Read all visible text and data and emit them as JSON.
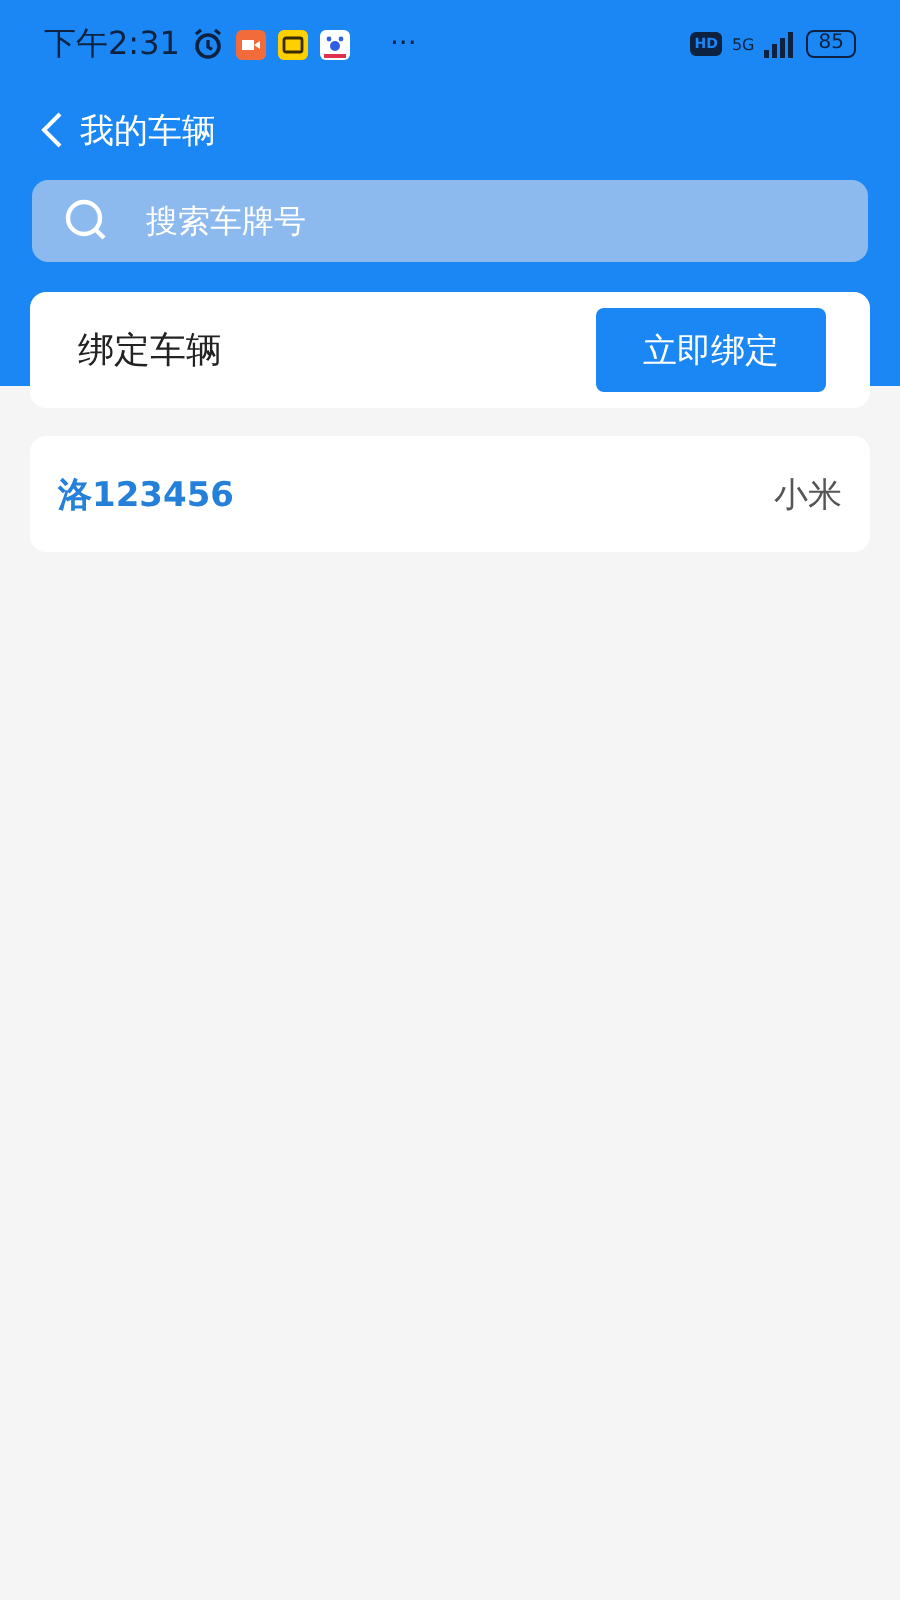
{
  "status_bar": {
    "time": "下午2:31",
    "more": "···",
    "hd": "HD",
    "network": "5G",
    "battery": "85"
  },
  "header": {
    "title": "我的车辆"
  },
  "search": {
    "placeholder": "搜索车牌号"
  },
  "bind_card": {
    "label": "绑定车辆",
    "button": "立即绑定"
  },
  "vehicles": [
    {
      "plate": "洛123456",
      "brand": "小米"
    }
  ]
}
